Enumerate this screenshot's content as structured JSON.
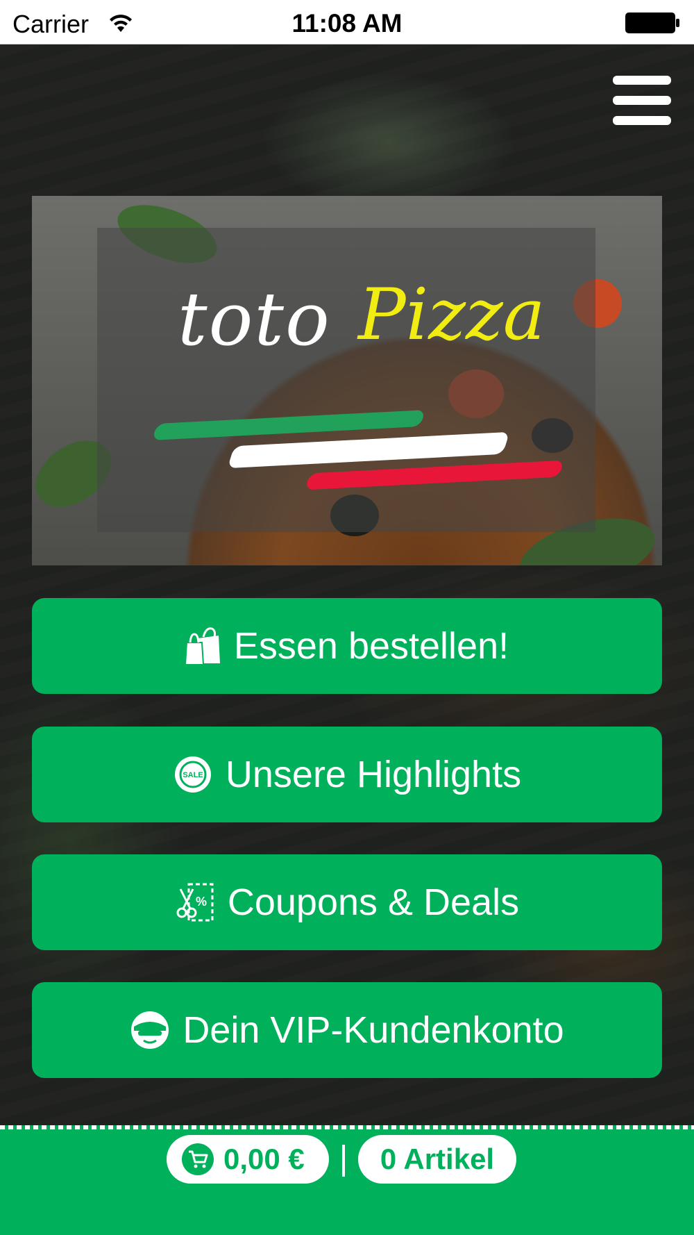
{
  "status_bar": {
    "carrier": "Carrier",
    "time": "11:08 AM"
  },
  "hero": {
    "logo_word1": "toto",
    "logo_word2": "Pizza"
  },
  "buttons": [
    {
      "label": "Essen bestellen!",
      "icon": "shopping-bags-icon"
    },
    {
      "label": "Unsere Highlights",
      "icon": "sale-badge-icon"
    },
    {
      "label": "Coupons & Deals",
      "icon": "coupon-scissors-icon"
    },
    {
      "label": "Dein VIP-Kundenkonto",
      "icon": "vip-user-icon"
    }
  ],
  "cart": {
    "total": "0,00 €",
    "items": "0 Artikel"
  },
  "colors": {
    "accent_green": "#00b05a",
    "logo_yellow": "#f1ec12"
  }
}
